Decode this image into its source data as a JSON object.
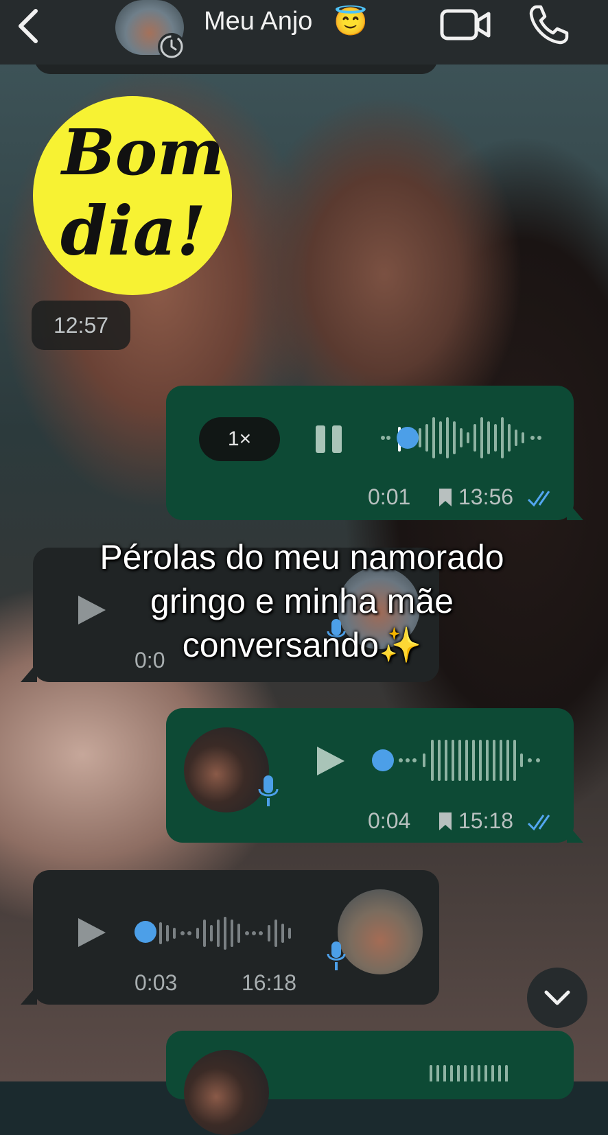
{
  "header": {
    "contact_name": "Meu Anjo",
    "contact_emoji": "😇",
    "back_icon": "chevron-left-icon",
    "video_icon": "video-camera-icon",
    "call_icon": "phone-icon"
  },
  "sticker": {
    "line1": "Bom",
    "line2": "dia!"
  },
  "messages": [
    {
      "side": "in",
      "time": "12:57"
    },
    {
      "side": "out",
      "playback_speed": "1×",
      "duration": "0:01",
      "time": "13:56"
    },
    {
      "side": "in",
      "duration": "0:0"
    },
    {
      "side": "out",
      "duration": "0:04",
      "time": "15:18"
    },
    {
      "side": "in",
      "duration": "0:03",
      "time": "16:18"
    }
  ],
  "overlay": {
    "line1": "Pérolas do meu namorado",
    "line2": "gringo e minha mãe",
    "line3": "conversando",
    "emoji": "✨"
  },
  "colors": {
    "outgoing": "#0d4a35",
    "incoming": "#202425",
    "accent": "#4c9fe8",
    "sticker": "#f7f233"
  }
}
